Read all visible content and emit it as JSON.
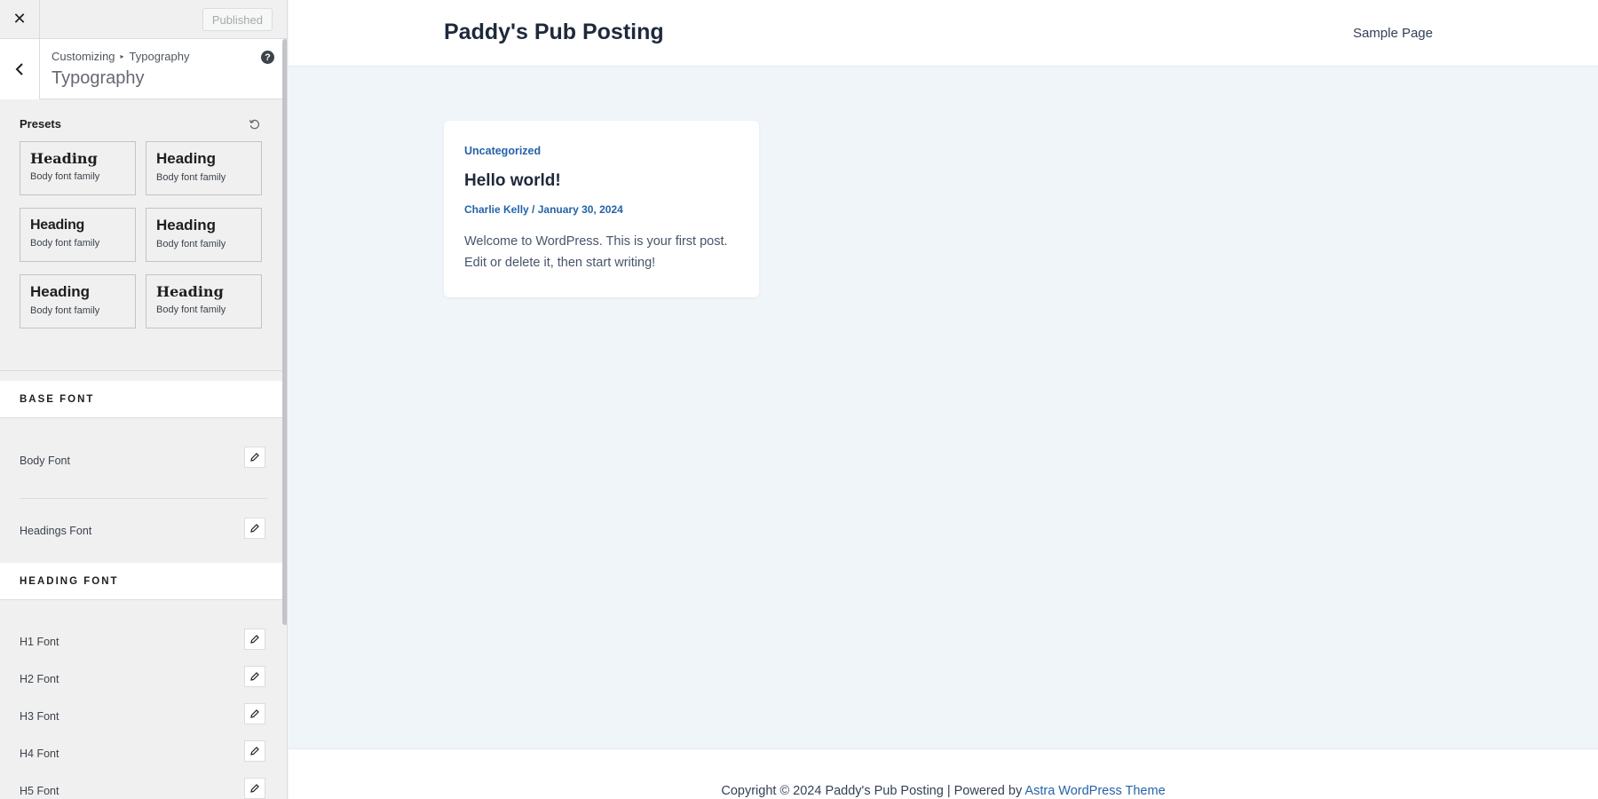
{
  "sidebar": {
    "close_label": "✕",
    "publish_label": "Published",
    "breadcrumb": {
      "root": "Customizing",
      "separator": "▸",
      "current": "Typography"
    },
    "title": "Typography",
    "help_label": "?",
    "presets": {
      "label": "Presets",
      "items": [
        {
          "heading": "Heading",
          "body": "Body font family"
        },
        {
          "heading": "Heading",
          "body": "Body font family"
        },
        {
          "heading": "Heading",
          "body": "Body font family"
        },
        {
          "heading": "Heading",
          "body": "Body font family"
        },
        {
          "heading": "Heading",
          "body": "Body font family"
        },
        {
          "heading": "Heading",
          "body": "Body font family"
        }
      ]
    },
    "base_font": {
      "title": "BASE FONT",
      "rows": [
        {
          "label": "Body Font"
        },
        {
          "label": "Headings Font"
        }
      ]
    },
    "heading_font": {
      "title": "HEADING FONT",
      "rows": [
        {
          "label": "H1 Font"
        },
        {
          "label": "H2 Font"
        },
        {
          "label": "H3 Font"
        },
        {
          "label": "H4 Font"
        },
        {
          "label": "H5 Font"
        }
      ]
    }
  },
  "preview": {
    "site_title": "Paddy's Pub Posting",
    "nav": {
      "sample_page": "Sample Page"
    },
    "post": {
      "category": "Uncategorized",
      "title": "Hello world!",
      "author": "Charlie Kelly",
      "meta_sep": " / ",
      "date": "January 30, 2024",
      "excerpt": "Welcome to WordPress. This is your first post. Edit or delete it, then start writing!"
    },
    "footer": {
      "text": "Copyright © 2024 Paddy's Pub Posting | Powered by ",
      "link": "Astra WordPress Theme"
    }
  },
  "colors": {
    "accent": "#2563a8",
    "heading": "#1e293b",
    "bg": "#f0f5fa"
  }
}
